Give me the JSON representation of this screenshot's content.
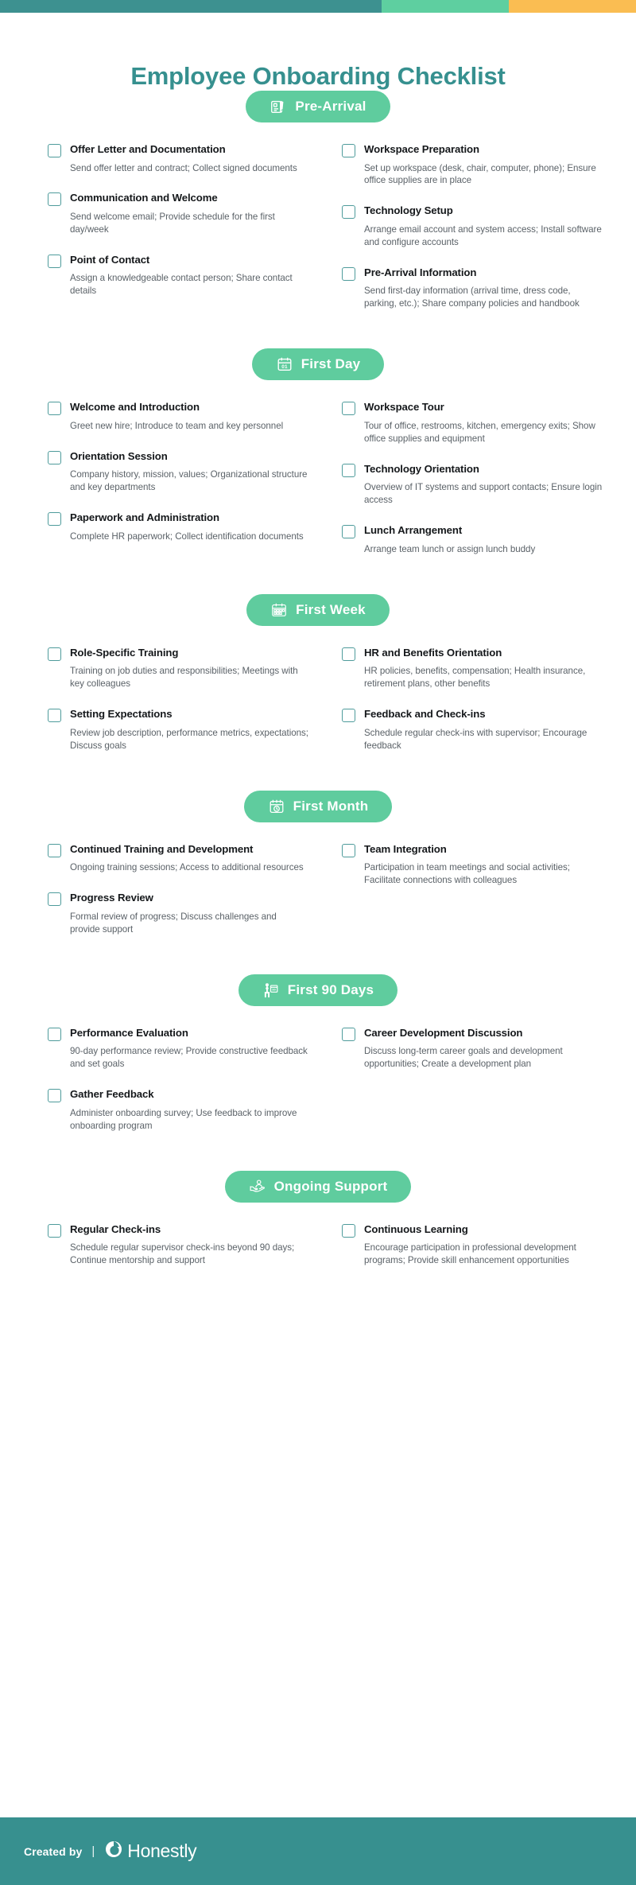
{
  "topbar": {
    "segments": [
      {
        "name": "teal-segment",
        "color": "#3d9190"
      },
      {
        "name": "green-segment",
        "color": "#5ecfa0"
      },
      {
        "name": "orange-segment",
        "color": "#fabd52"
      }
    ]
  },
  "title": "Employee Onboarding Checklist",
  "colors": {
    "title": "#36908f",
    "badge_bg": "#5fcc9e",
    "checkbox_border": "#4e9b9b",
    "footer_bg": "#37908f",
    "item_title": "#15181b",
    "item_desc": "#5b6268"
  },
  "sections": [
    {
      "label": "Pre-Arrival",
      "icon": "id-card-pen-icon",
      "items": [
        {
          "title": "Offer Letter and Documentation",
          "desc": "Send offer letter and contract; Collect signed documents"
        },
        {
          "title": "Workspace Preparation",
          "desc": "Set up workspace (desk, chair, computer, phone); Ensure office supplies are in place"
        },
        {
          "title": "Communication and Welcome",
          "desc": "Send welcome email; Provide schedule for the first day/week"
        },
        {
          "title": "Technology Setup",
          "desc": "Arrange email account and system access; Install software and configure accounts"
        },
        {
          "title": "Point of Contact",
          "desc": "Assign a knowledgeable contact person; Share contact details"
        },
        {
          "title": "Pre-Arrival Information",
          "desc": "Send first-day information (arrival time, dress code, parking, etc.); Share company policies and handbook"
        }
      ]
    },
    {
      "label": "First Day",
      "icon": "calendar-day-01-icon",
      "items": [
        {
          "title": "Welcome and Introduction",
          "desc": "Greet new hire; Introduce to team and key personnel"
        },
        {
          "title": "Workspace Tour",
          "desc": "Tour of office, restrooms, kitchen, emergency exits; Show office supplies and equipment"
        },
        {
          "title": "Orientation Session",
          "desc": "Company history, mission, values; Organizational structure and key departments"
        },
        {
          "title": "Technology Orientation",
          "desc": "Overview of IT systems and support contacts; Ensure login access"
        },
        {
          "title": "Paperwork and Administration",
          "desc": "Complete HR paperwork; Collect identification documents"
        },
        {
          "title": "Lunch Arrangement",
          "desc": "Arrange team lunch or assign lunch buddy"
        }
      ]
    },
    {
      "label": "First Week",
      "icon": "calendar-week-icon",
      "items": [
        {
          "title": "Role-Specific Training",
          "desc": "Training on job duties and responsibilities; Meetings with key colleagues"
        },
        {
          "title": "HR and Benefits Orientation",
          "desc": "HR policies, benefits, compensation; Health insurance, retirement plans, other benefits"
        },
        {
          "title": "Setting Expectations",
          "desc": "Review job description, performance metrics, expectations; Discuss goals"
        },
        {
          "title": "Feedback and Check-ins",
          "desc": "Schedule regular check-ins with supervisor; Encourage feedback"
        }
      ]
    },
    {
      "label": "First Month",
      "icon": "calendar-clock-icon",
      "items": [
        {
          "title": "Continued Training and Development",
          "desc": "Ongoing training sessions; Access to additional resources"
        },
        {
          "title": "Team Integration",
          "desc": "Participation in team meetings and social activities; Facilitate connections with colleagues"
        },
        {
          "title": "Progress Review",
          "desc": "Formal review of progress; Discuss challenges and provide support"
        },
        {
          "title": "",
          "desc": ""
        }
      ]
    },
    {
      "label": "First 90 Days",
      "icon": "person-calendar-90-icon",
      "items": [
        {
          "title": "Performance Evaluation",
          "desc": "90-day performance review; Provide constructive feedback and set goals"
        },
        {
          "title": "Career Development Discussion",
          "desc": "Discuss long-term career goals and development opportunities; Create a development plan"
        },
        {
          "title": "Gather Feedback",
          "desc": "Administer onboarding survey; Use feedback to improve onboarding program"
        },
        {
          "title": "",
          "desc": ""
        }
      ]
    },
    {
      "label": "Ongoing Support",
      "icon": "hand-person-support-icon",
      "items": [
        {
          "title": "Regular Check-ins",
          "desc": "Schedule regular supervisor check-ins beyond 90 days; Continue mentorship and support"
        },
        {
          "title": "Continuous Learning",
          "desc": "Encourage participation in professional development programs; Provide skill enhancement opportunities"
        }
      ]
    }
  ],
  "footer": {
    "created_by": "Created by",
    "divider": "|",
    "brand": "Honestly"
  }
}
